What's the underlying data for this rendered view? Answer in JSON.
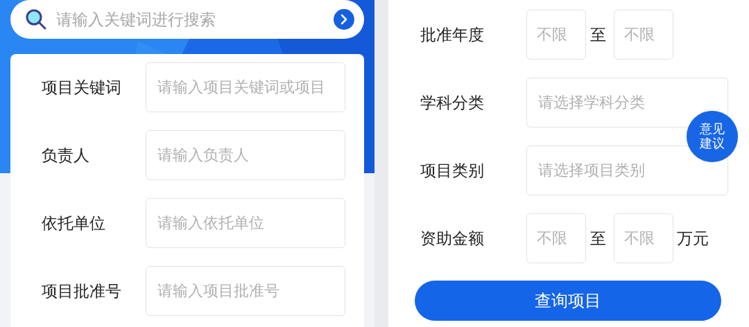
{
  "left": {
    "search": {
      "placeholder": "请输入关键词进行搜索"
    },
    "fields": [
      {
        "label": "项目关键词",
        "placeholder": "请输入项目关键词或项目"
      },
      {
        "label": "负责人",
        "placeholder": "请输入负责人"
      },
      {
        "label": "依托单位",
        "placeholder": "请输入依托单位"
      },
      {
        "label": "项目批准号",
        "placeholder": "请输入项目批准号"
      }
    ]
  },
  "right": {
    "rows": [
      {
        "kind": "range",
        "label": "批准年度",
        "from": {
          "placeholder": "不限"
        },
        "separator": "至",
        "to": {
          "placeholder": "不限"
        }
      },
      {
        "kind": "select",
        "label": "学科分类",
        "placeholder": "请选择学科分类"
      },
      {
        "kind": "select",
        "label": "项目类别",
        "placeholder": "请选择项目类别"
      },
      {
        "kind": "range",
        "label": "资助金额",
        "from": {
          "placeholder": "不限"
        },
        "separator": "至",
        "to": {
          "placeholder": "不限"
        },
        "unit": "万元"
      }
    ],
    "submit": "查询项目",
    "feedback": "意见建议"
  }
}
